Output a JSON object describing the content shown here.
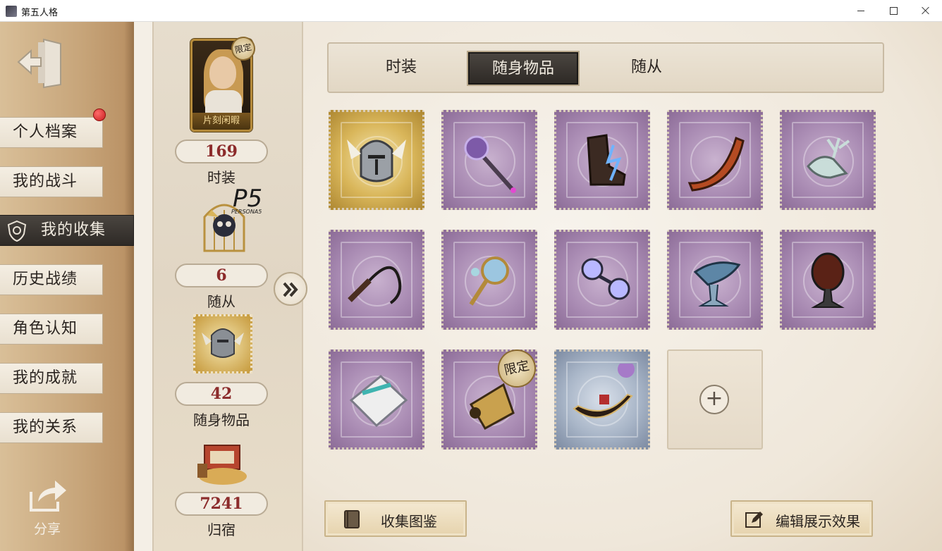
{
  "window": {
    "title": "第五人格"
  },
  "menu": {
    "items": [
      {
        "label": "个人档案",
        "active": false,
        "has_dot": true
      },
      {
        "label": "我的战斗",
        "active": false
      },
      {
        "label": "我的收集",
        "active": true
      },
      {
        "label": "历史战绩",
        "active": false
      },
      {
        "label": "角色认知",
        "active": false
      },
      {
        "label": "我的成就",
        "active": false
      },
      {
        "label": "我的关系",
        "active": false
      }
    ],
    "share_label": "分享"
  },
  "stats": {
    "portrait_caption": "片刻闲暇",
    "portrait_tag": "限定",
    "follower_logo": "P5",
    "follower_logo_sub": "PERSONA5",
    "costume": {
      "value": "169",
      "label": "时装"
    },
    "follower": {
      "value": "6",
      "label": "随从"
    },
    "accessory": {
      "value": "42",
      "label": "随身物品"
    },
    "home": {
      "value": "7241",
      "label": "归宿"
    }
  },
  "tabs": [
    {
      "label": "时装",
      "active": false
    },
    {
      "label": "随身物品",
      "active": true
    },
    {
      "label": "随从",
      "active": false
    }
  ],
  "items": [
    {
      "frame": "gold",
      "icon": "winged-helmet-icon"
    },
    {
      "frame": "purple",
      "icon": "crystal-scepter-icon"
    },
    {
      "frame": "purple",
      "icon": "lightning-boot-icon"
    },
    {
      "frame": "purple",
      "icon": "boomerang-icon"
    },
    {
      "frame": "purple",
      "icon": "deer-head-icon"
    },
    {
      "frame": "purple",
      "icon": "whip-icon"
    },
    {
      "frame": "purple",
      "icon": "ornate-mirror-icon"
    },
    {
      "frame": "purple",
      "icon": "orb-goggles-icon"
    },
    {
      "frame": "purple",
      "icon": "dolphin-goblet-icon"
    },
    {
      "frame": "purple",
      "icon": "dark-goblet-icon"
    },
    {
      "frame": "purple",
      "icon": "feather-pillow-icon"
    },
    {
      "frame": "purple",
      "icon": "golden-lantern-icon",
      "tag": "限定"
    },
    {
      "frame": "blue",
      "icon": "gondola-icon"
    },
    {
      "frame": "empty",
      "icon": "plus-icon"
    }
  ],
  "buttons": {
    "collection_guide": "收集图鉴",
    "edit_display": "编辑展示效果"
  },
  "colors": {
    "accent_dark": "#2e2a26",
    "stat_red": "#8c2b2b",
    "notification_red": "#c81f1f"
  }
}
